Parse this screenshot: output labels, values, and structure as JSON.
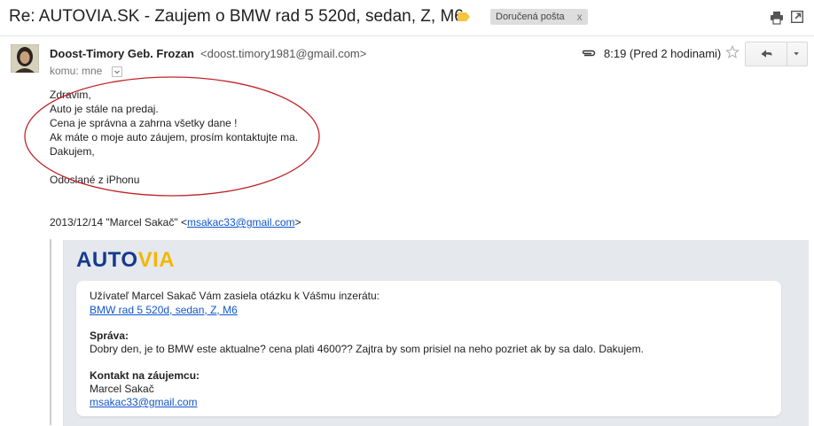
{
  "subject": "Re: AUTOVIA.SK - Zaujem o BMW rad 5 520d, sedan, Z, M6",
  "label_chip": {
    "label": "Doručená pošta",
    "remove": "x"
  },
  "header": {
    "sender_name": "Doost-Timory Geb. Frozan",
    "sender_email": "<doost.timory1981@gmail.com>",
    "to": "komu: mne",
    "time": "8:19 (Pred 2 hodinami)"
  },
  "body": {
    "lines": [
      "Zdravim,",
      "Auto je stále na predaj.",
      "Cena je správna a zahrna všetky dane !",
      "Ak máte o moje auto záujem, prosím kontaktujte ma.",
      "Dakujem,",
      "",
      "Odoslané z iPhonu"
    ]
  },
  "quote_header": {
    "prefix": "2013/12/14 \"Marcel Sakač\" <",
    "email": "msakac33@gmail.com",
    "suffix": ">"
  },
  "quoted": {
    "logo_auto": "AUTO",
    "logo_via": "VIA",
    "intro": "Užívateľ Marcel Sakač Vám zasiela otázku k Vášmu inzerátu:",
    "ad_link": "BMW rad 5 520d, sedan, Z, M6",
    "message_label": "Správa:",
    "message": "Dobry den, je to BMW este aktualne? cena plati 4600?? Zajtra by som prisiel na neho pozriet ak by sa dalo. Dakujem.",
    "contact_label": "Kontakt na záujemcu:",
    "contact_name": "Marcel Sakač",
    "contact_email": "msakac33@gmail.com"
  },
  "colors": {
    "link": "#1155cc",
    "logo_blue": "#143a8f",
    "logo_yellow": "#f2b705",
    "label_tag": "#f4c542",
    "annotation": "#c0252a"
  },
  "icons": [
    "label-tag-icon",
    "print-icon",
    "new-window-icon",
    "paperclip-icon",
    "star-icon",
    "reply-icon",
    "chevron-down-icon"
  ]
}
